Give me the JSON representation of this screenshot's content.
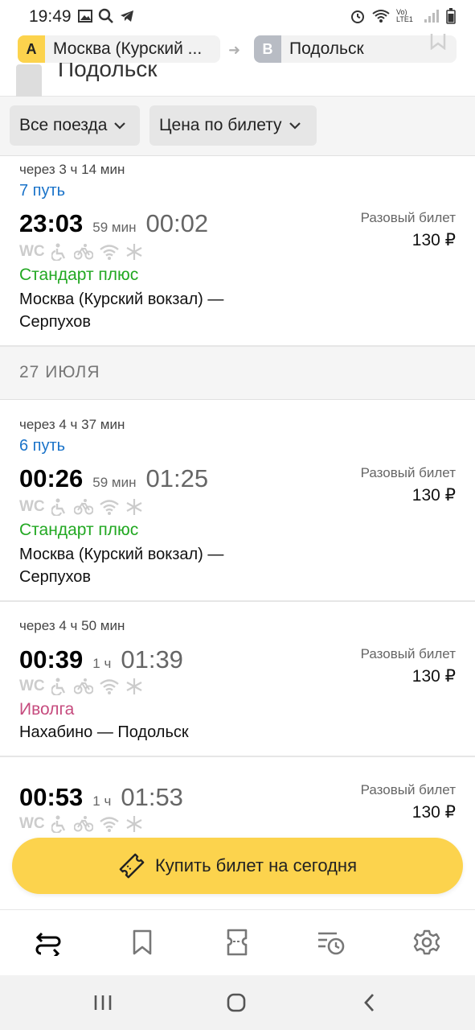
{
  "statusbar": {
    "time": "19:49",
    "network": "Vo) LTE1"
  },
  "route": {
    "from_letter": "A",
    "from_label": "Москва (Курский ...",
    "to_letter": "B",
    "to_label": "Подольск",
    "ghost_title": "Подольск"
  },
  "filters": {
    "trains": "Все поезда",
    "price": "Цена по билету"
  },
  "cards": [
    {
      "wait": "через 3 ч 14 мин",
      "platform": "7 путь",
      "dep": "23:03",
      "dur": "59 мин",
      "arr": "00:02",
      "class": "Стандарт плюс",
      "route_line1": "Москва (Курский вокзал) —",
      "route_line2": "Серпухов",
      "ticket_type": "Разовый билет",
      "price": "130 ₽"
    },
    {
      "wait": "через 4 ч 37 мин",
      "platform": "6 путь",
      "dep": "00:26",
      "dur": "59 мин",
      "arr": "01:25",
      "class": "Стандарт плюс",
      "route_line1": "Москва (Курский вокзал) —",
      "route_line2": "Серпухов",
      "ticket_type": "Разовый билет",
      "price": "130 ₽"
    },
    {
      "wait": "через 4 ч 50 мин",
      "dep": "00:39",
      "dur": "1 ч",
      "arr": "01:39",
      "class": "Иволга",
      "route_line1": "Нахабино — Подольск",
      "ticket_type": "Разовый билет",
      "price": "130 ₽"
    },
    {
      "dep": "00:53",
      "dur": "1 ч",
      "arr": "01:53",
      "ticket_type": "Разовый билет",
      "price": "130 ₽"
    }
  ],
  "date_header": "27 ИЮЛЯ",
  "features": {
    "wc": "WC"
  },
  "buy_button": "Купить билет на сегодня",
  "tabs": [
    "route-icon",
    "bookmark-icon",
    "ticket-icon",
    "history-icon",
    "settings-icon"
  ],
  "colors": {
    "accent_yellow": "#fcd34d",
    "platform_blue": "#1a73c9",
    "class_green": "#22a822",
    "class_pink": "#c64b7e"
  }
}
